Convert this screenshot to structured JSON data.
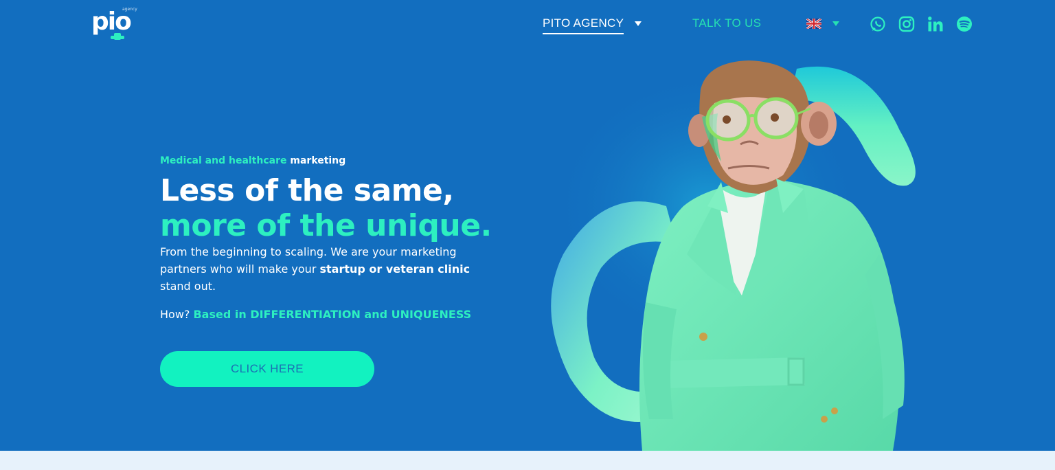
{
  "header": {
    "logo_text": "pio",
    "logo_small": "agency",
    "nav": {
      "agency_label": "PITO AGENCY",
      "talk_label": "TALK TO US"
    },
    "language": "en-gb-flag",
    "social": [
      "whatsapp-icon",
      "instagram-icon",
      "linkedin-icon",
      "spotify-icon"
    ]
  },
  "hero": {
    "eyebrow_accent": "Medical and healthcare",
    "eyebrow_plain": "marketing",
    "headline_line1": "Less of the same,",
    "headline_line2": "more of the unique.",
    "desc_part1": "From the beginning to scaling. We are your marketing partners who will make your ",
    "desc_bold": "startup or veteran clinic",
    "desc_part2": " stand out.",
    "how_prefix": "How? ",
    "how_accent": "Based in DIFFERENTIATION and UNIQUENESS",
    "cta_label": "CLICK HERE"
  },
  "colors": {
    "background": "#126ebf",
    "accent": "#2df0c0",
    "cta": "#12f2c0",
    "strip": "#e7f2fb"
  }
}
